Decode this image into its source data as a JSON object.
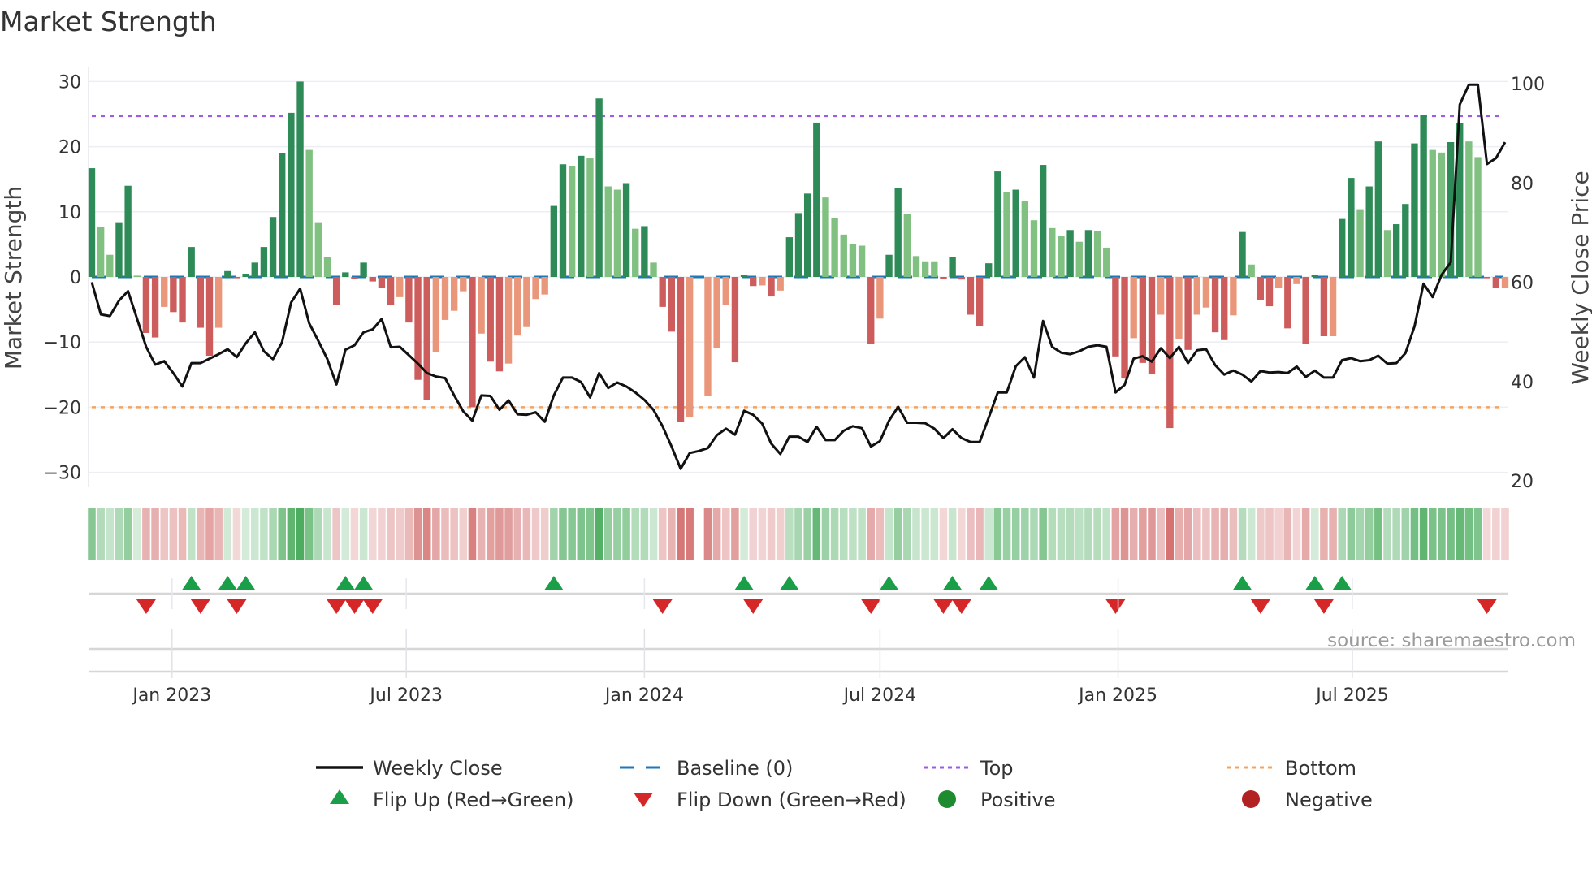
{
  "chart_data": {
    "type": "bar",
    "title": "Market Strength",
    "ylabel": "Market Strength",
    "y2label": "Weekly Close Price",
    "ylim": [
      -33,
      33
    ],
    "y2lim": [
      17,
      105
    ],
    "yticks": [
      30,
      20,
      10,
      0,
      -10,
      -20,
      -30
    ],
    "y2ticks": [
      100,
      80,
      60,
      40,
      20
    ],
    "ytick_labels": [
      "30",
      "20",
      "10",
      "0",
      "−10",
      "−20",
      "−30"
    ],
    "y2tick_labels": [
      "100",
      "80",
      "60",
      "40",
      "20"
    ],
    "x_start": "2022-10-31",
    "x_interval": "weekly",
    "xticks": [
      {
        "date": "2023-01-01",
        "label": "Jan 2023"
      },
      {
        "date": "2023-07-01",
        "label": "Jul 2023"
      },
      {
        "date": "2024-01-01",
        "label": "Jan 2024"
      },
      {
        "date": "2024-07-01",
        "label": "Jul 2024"
      },
      {
        "date": "2025-01-01",
        "label": "Jan 2025"
      },
      {
        "date": "2025-07-01",
        "label": "Jul 2025"
      }
    ],
    "top_level": 24.7,
    "bottom_level": -20,
    "baseline": 0,
    "grid": true,
    "series": [
      {
        "name": "Market Strength",
        "type": "bar",
        "values": [
          16.7,
          7.7,
          3.4,
          8.4,
          14,
          0.2,
          -8.6,
          -9.3,
          -4.6,
          -5.4,
          -7.0,
          4.6,
          -7.8,
          -12.1,
          -7.8,
          0.9,
          -0.2,
          0.5,
          2.2,
          4.6,
          9.2,
          19.0,
          25.2,
          30.0,
          19.5,
          8.4,
          3.0,
          -4.3,
          0.7,
          -0.3,
          2.2,
          -0.7,
          -1.7,
          -4.3,
          -3.1,
          -7.0,
          -15.8,
          -18.9,
          -11.5,
          -6.6,
          -5.2,
          -2.2,
          -20.0,
          -8.7,
          -13.0,
          -14.5,
          -13.3,
          -9.0,
          -7.7,
          -3.4,
          -2.7,
          10.9,
          17.3,
          17.0,
          18.6,
          18.2,
          27.4,
          13.9,
          13.4,
          14.4,
          7.4,
          7.8,
          2.2,
          -4.6,
          -8.4,
          -22.3,
          -21.5,
          0,
          -18.3,
          -10.9,
          -4.3,
          -13.1,
          0.3,
          -1.4,
          -1.3,
          -3.0,
          -2.1,
          6.1,
          9.8,
          12.8,
          23.7,
          12.2,
          9.0,
          6.5,
          5.0,
          4.8,
          -10.3,
          -6.4,
          3.4,
          13.7,
          9.7,
          3.2,
          2.4,
          2.4,
          -0.3,
          3.0,
          -0.4,
          -5.8,
          -7.6,
          2.1,
          16.2,
          13.0,
          13.4,
          11.7,
          8.7,
          17.2,
          7.5,
          6.3,
          7.2,
          5.4,
          7.2,
          7.0,
          4.5,
          -12.2,
          -15.6,
          -9.4,
          -13.2,
          -14.9,
          -5.8,
          -23.2,
          -9.5,
          -11.2,
          -5.8,
          -4.7,
          -8.5,
          -9.7,
          -5.9,
          6.9,
          1.9,
          -3.5,
          -4.5,
          -1.7,
          -7.9,
          -1.1,
          -10.3,
          0.3,
          -9.1,
          -9.1,
          8.9,
          15.2,
          10.4,
          13.9,
          20.8,
          7.2,
          8.1,
          11.2,
          20.5,
          24.9,
          19.5,
          19.1,
          20.7,
          23.6,
          20.8,
          18.4,
          -0.2,
          -1.7,
          -1.7
        ]
      },
      {
        "name": "Weekly Close",
        "type": "line",
        "axis": "right",
        "values": [
          60,
          53.5,
          53.2,
          56.3,
          58.2,
          52.6,
          47,
          43.4,
          44.1,
          41.7,
          39,
          43.7,
          43.7,
          44.6,
          45.5,
          46.5,
          44.9,
          47.7,
          49.9,
          46.1,
          44.5,
          47.9,
          55.9,
          58.7,
          51.7,
          48.2,
          44.5,
          39.4,
          46.4,
          47.3,
          49.9,
          50.5,
          52.6,
          46.9,
          47,
          45.3,
          43.6,
          41.7,
          41,
          40.7,
          37.2,
          34,
          32.1,
          37.2,
          37.1,
          34.3,
          36.2,
          33.4,
          33.3,
          33.8,
          31.9,
          37.2,
          40.8,
          40.8,
          39.9,
          36.8,
          41.7,
          38.7,
          39.8,
          39,
          37.8,
          36.3,
          34.3,
          31,
          26.9,
          22.4,
          25.6,
          26,
          26.6,
          29.2,
          30.5,
          29.3,
          34.1,
          33.3,
          31.5,
          27.5,
          25.4,
          28.9,
          28.9,
          27.8,
          30.9,
          28.2,
          28.2,
          30.1,
          31,
          30.6,
          26.9,
          28,
          32.1,
          34.9,
          31.7,
          31.7,
          31.6,
          30.5,
          28.6,
          30.4,
          28.6,
          27.8,
          27.8,
          32.7,
          37.8,
          37.8,
          43.1,
          44.9,
          40.8,
          52.2,
          47,
          45.8,
          45.5,
          46.1,
          47,
          47.3,
          47,
          37.8,
          39.3,
          44.6,
          45.1,
          44,
          46.7,
          44.7,
          47,
          43.7,
          46.3,
          46.5,
          43.3,
          41.4,
          42.2,
          41.4,
          40,
          42.1,
          41.8,
          41.9,
          41.7,
          43,
          40.9,
          42.2,
          40.8,
          40.8,
          44.3,
          44.7,
          44.1,
          44.3,
          45.2,
          43.6,
          43.7,
          45.7,
          51.1,
          59.7,
          57,
          61.5,
          64,
          95.8,
          99.8,
          99.8,
          83.8,
          85,
          88.2
        ]
      }
    ],
    "flip_up_weeks": [
      11,
      15,
      17,
      28,
      30,
      51,
      72,
      77,
      88,
      95,
      99,
      127,
      135,
      138
    ],
    "flip_down_weeks": [
      6,
      12,
      16,
      27,
      29,
      31,
      63,
      73,
      86,
      94,
      96,
      113,
      129,
      136,
      154
    ],
    "legend": {
      "placement": "bottom",
      "items": [
        {
          "label": "Weekly Close",
          "symbol": "line"
        },
        {
          "label": "Baseline (0)",
          "symbol": "dash"
        },
        {
          "label": "Top",
          "symbol": "dot-purple"
        },
        {
          "label": "Bottom",
          "symbol": "dot-orange"
        },
        {
          "label": "Flip Up (Red→Green)",
          "symbol": "triangle-up"
        },
        {
          "label": "Flip Down (Green→Red)",
          "symbol": "triangle-down"
        },
        {
          "label": "Positive",
          "symbol": "circle-green"
        },
        {
          "label": "Negative",
          "symbol": "circle-red"
        }
      ]
    },
    "source": "source: sharemaestro.com",
    "colors": {
      "pos_strong": "#2e8b57",
      "pos_weak": "#80c080",
      "neg_strong": "#cd5c5c",
      "neg_weak": "#e9967a",
      "line": "#111111",
      "baseline": "#1f77b4",
      "top": "#9b5de5",
      "bottom": "#f4a460",
      "flip_up": "#1a9e48",
      "flip_down": "#d62728",
      "positive": "#1e8c2e",
      "negative": "#b22222"
    }
  }
}
